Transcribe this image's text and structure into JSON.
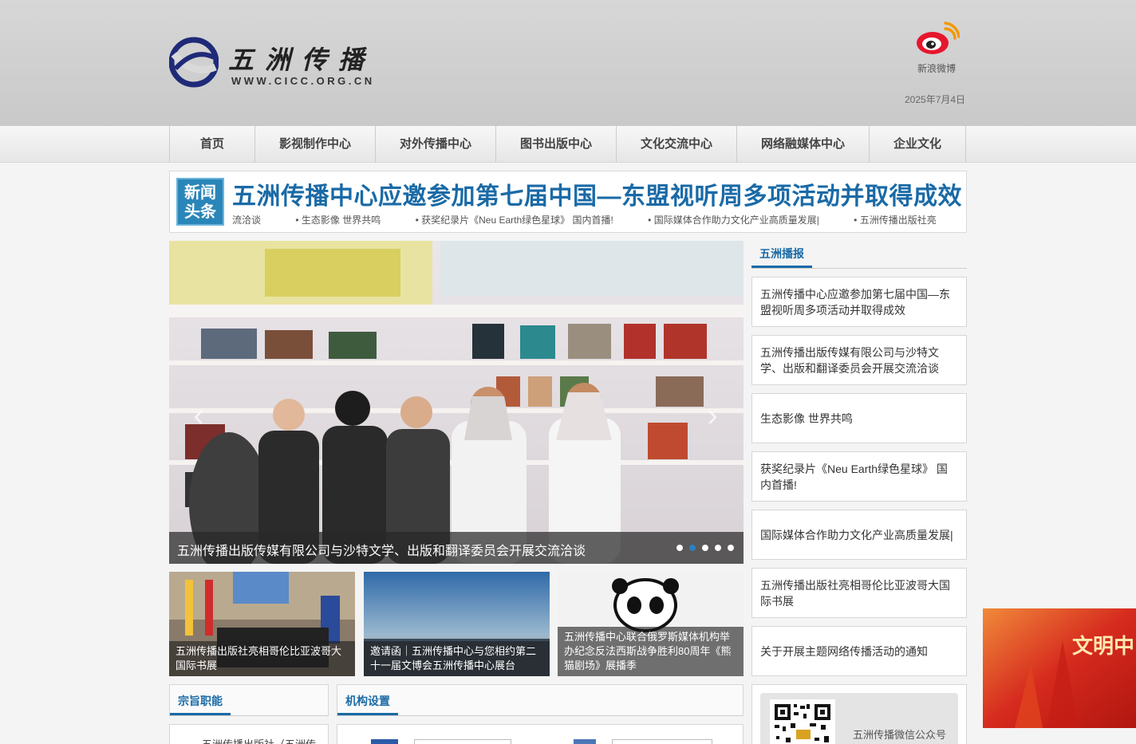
{
  "header": {
    "logo_title": "五洲传播",
    "logo_url": "WWW.CICC.ORG.CN",
    "weibo_label": "新浪微博",
    "date": "2025年7月4日"
  },
  "nav": {
    "items": [
      {
        "label": "首页"
      },
      {
        "label": "影视制作中心"
      },
      {
        "label": "对外传播中心"
      },
      {
        "label": "图书出版中心"
      },
      {
        "label": "文化交流中心"
      },
      {
        "label": "网络融媒体中心"
      },
      {
        "label": "企业文化"
      }
    ]
  },
  "headline": {
    "badge_line1": "新闻",
    "badge_line2": "头条",
    "title": "五洲传播中心应邀参加第七届中国—东盟视听周多项活动并取得成效",
    "ticker": [
      "流洽谈",
      "• 生态影像 世界共鸣",
      "• 获奖纪录片《Neu Earth绿色星球》 国内首播!",
      "• 国际媒体合作助力文化产业高质量发展|",
      "• 五洲传播出版社亮"
    ]
  },
  "slider": {
    "caption": "五洲传播出版传媒有限公司与沙特文学、出版和翻译委员会开展交流洽谈",
    "prev_glyph": "‹",
    "next_glyph": "›",
    "dot_count": 5,
    "active_dot": 1
  },
  "thumbnails": [
    {
      "caption": "五洲传播出版社亮相哥伦比亚波哥大国际书展"
    },
    {
      "caption": "邀请函｜五洲传播中心与您相约第二十一届文博会五洲传播中心展台"
    },
    {
      "caption": "五洲传播中心联合俄罗斯媒体机构举办纪念反法西斯战争胜利80周年《熊猫剧场》展播季"
    }
  ],
  "sidebar": {
    "heading": "五洲播报",
    "items": [
      {
        "label": "五洲传播中心应邀参加第七届中国—东盟视听周多项活动并取得成效"
      },
      {
        "label": "五洲传播出版传媒有限公司与沙特文学、出版和翻译委员会开展交流洽谈"
      },
      {
        "label": "生态影像 世界共鸣"
      },
      {
        "label": "获奖纪录片《Neu Earth绿色星球》 国内首播!"
      },
      {
        "label": "国际媒体合作助力文化产业高质量发展|"
      },
      {
        "label": "五洲传播出版社亮相哥伦比亚波哥大国际书展"
      },
      {
        "label": "关于开展主题网络传播活动的通知"
      }
    ],
    "wechat_label": "五洲传播微信公众号"
  },
  "sections": {
    "mission": {
      "heading": "宗旨职能",
      "snippet": "五洲传播出版社（五洲传"
    },
    "org": {
      "heading": "机构设置"
    }
  },
  "float_ad": {
    "text": "文明中"
  },
  "colors": {
    "accent": "#1a6aa6",
    "badge": "#2a86b8"
  }
}
